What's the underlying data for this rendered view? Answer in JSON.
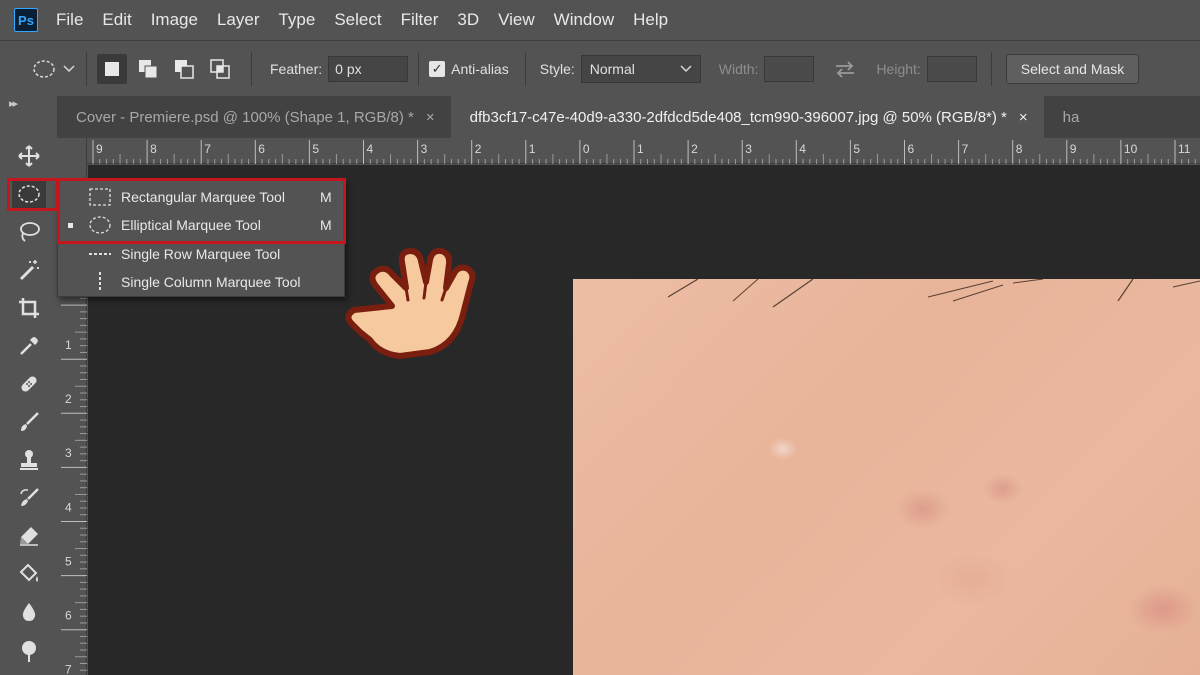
{
  "app": {
    "logo": "Ps"
  },
  "menu": [
    "File",
    "Edit",
    "Image",
    "Layer",
    "Type",
    "Select",
    "Filter",
    "3D",
    "View",
    "Window",
    "Help"
  ],
  "options": {
    "feather_label": "Feather:",
    "feather_value": "0 px",
    "antialias_label": "Anti-alias",
    "antialias_checked": true,
    "style_label": "Style:",
    "style_value": "Normal",
    "width_label": "Width:",
    "height_label": "Height:",
    "select_mask_label": "Select and Mask"
  },
  "tabs": [
    {
      "label": "Cover - Premiere.psd @ 100% (Shape 1, RGB/8) *",
      "active": false
    },
    {
      "label": "dfb3cf17-c47e-40d9-a330-2dfdcd5de408_tcm990-396007.jpg @ 50% (RGB/8*) *",
      "active": true
    },
    {
      "label": "ha",
      "active": false
    }
  ],
  "tab_close_glyph": "×",
  "ruler_top": [
    "9",
    "8",
    "7",
    "6",
    "5",
    "4",
    "3",
    "2",
    "1",
    "0",
    "1",
    "2",
    "3",
    "4",
    "5",
    "6",
    "7",
    "8",
    "9",
    "10",
    "11"
  ],
  "ruler_left": [
    "1",
    "2",
    "3",
    "4",
    "5",
    "6",
    "7"
  ],
  "flyout": [
    {
      "label": "Rectangular Marquee Tool",
      "key": "M",
      "icon": "rect-marquee-icon",
      "selected": false
    },
    {
      "label": "Elliptical Marquee Tool",
      "key": "M",
      "icon": "ellipse-marquee-icon",
      "selected": true
    },
    {
      "label": "Single Row Marquee Tool",
      "key": "",
      "icon": "single-row-icon",
      "selected": false
    },
    {
      "label": "Single Column Marquee Tool",
      "key": "",
      "icon": "single-column-icon",
      "selected": false
    }
  ],
  "tools": [
    "move-icon",
    "ellipse-marquee-icon",
    "lasso-icon",
    "magic-wand-icon",
    "crop-icon",
    "eyedropper-icon",
    "healing-brush-icon",
    "brush-icon",
    "clone-stamp-icon",
    "history-brush-icon",
    "eraser-icon",
    "paint-bucket-icon",
    "blur-icon",
    "dodge-icon"
  ],
  "colors": {
    "highlight": "#c4161c",
    "panel": "#535353",
    "canvas": "#282828",
    "accent": "#31a8ff"
  }
}
